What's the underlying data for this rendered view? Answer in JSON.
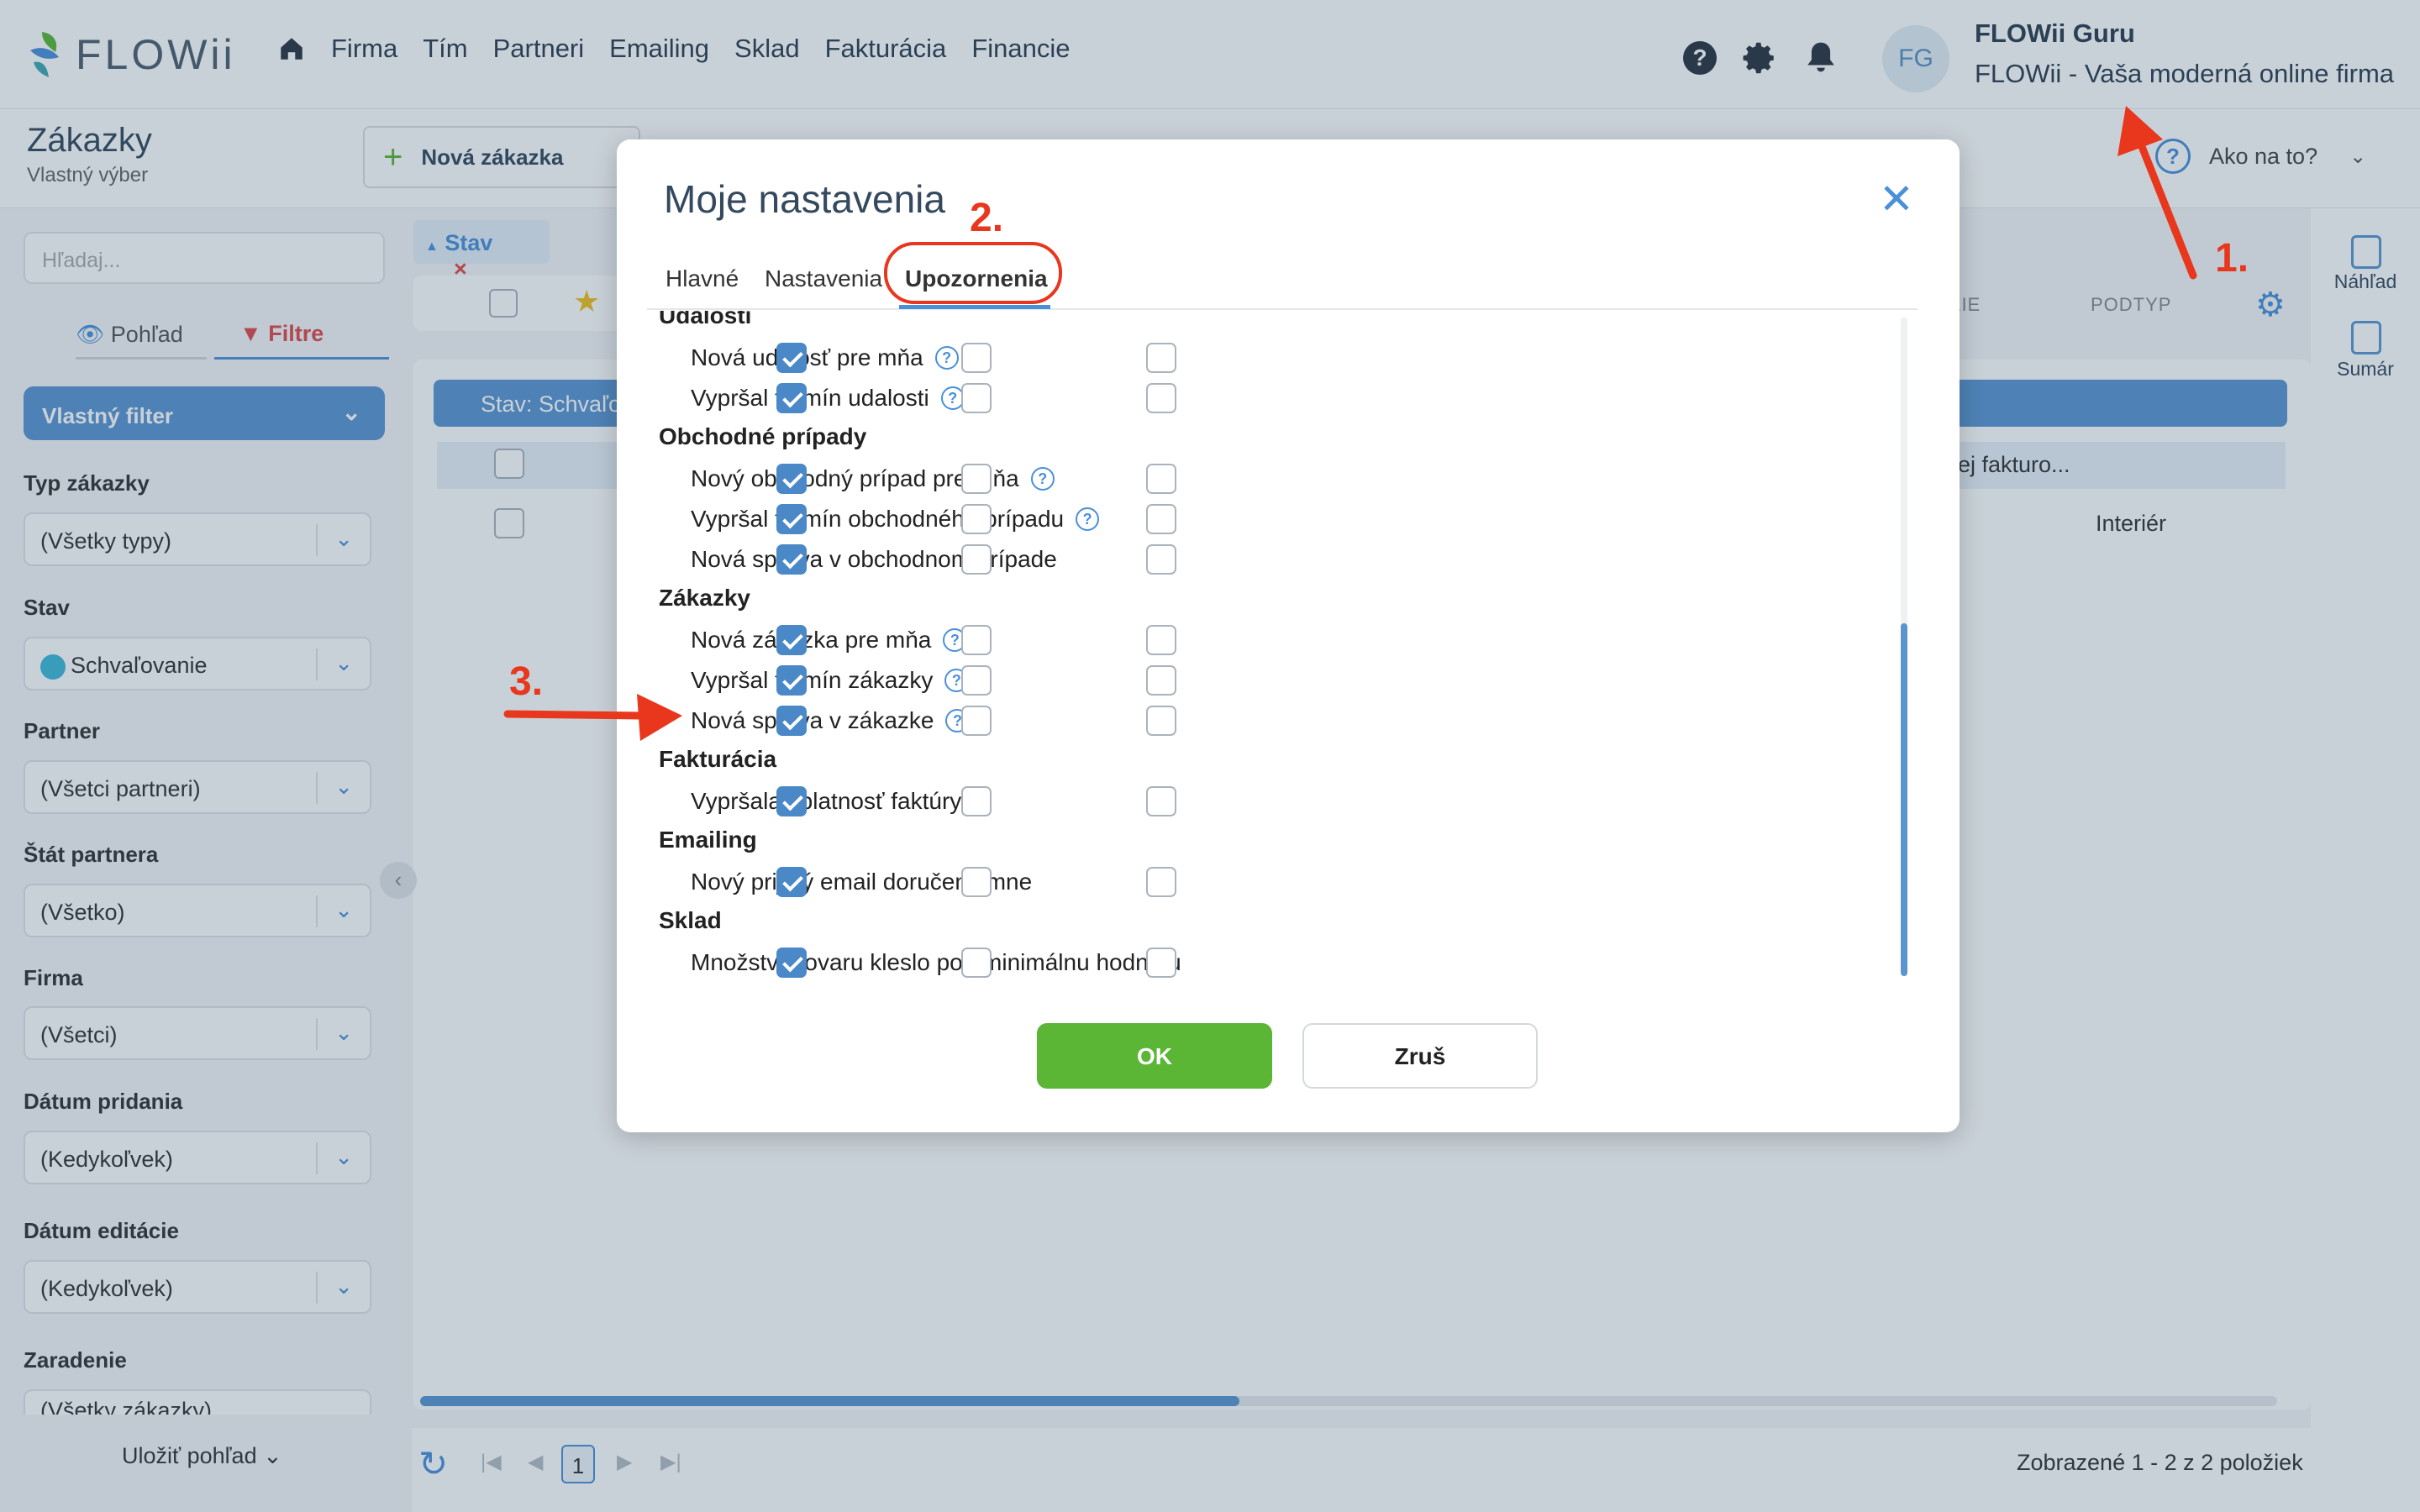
{
  "app": {
    "logo": "FLOWii"
  },
  "nav": [
    "Firma",
    "Tím",
    "Partneri",
    "Emailing",
    "Sklad",
    "Fakturácia",
    "Financie"
  ],
  "user": {
    "initials": "FG",
    "name": "FLOWii Guru",
    "company": "FLOWii - Vaša moderná online firma"
  },
  "page": {
    "title": "Zákazky",
    "subtitle": "Vlastný výber",
    "new_button": "Nová zákazka",
    "help": "Ako na to?"
  },
  "sidebar": {
    "search_placeholder": "Hľadaj...",
    "tab_view": "Pohľad",
    "tab_filters": "Filtre",
    "custom_filter": "Vlastný filter",
    "filters": [
      {
        "label": "Typ zákazky",
        "value": "(Všetky typy)"
      },
      {
        "label": "Stav",
        "value": "Schvaľovanie"
      },
      {
        "label": "Partner",
        "value": "(Všetci partneri)"
      },
      {
        "label": "Štát partnera",
        "value": "(Všetko)"
      },
      {
        "label": "Firma",
        "value": "(Všetci)"
      },
      {
        "label": "Dátum pridania",
        "value": "(Kedykoľvek)"
      },
      {
        "label": "Dátum editácie",
        "value": "(Kedykoľvek)"
      },
      {
        "label": "Zaradenie",
        "value": "(Všetky zákazky)"
      }
    ],
    "save_view": "Uložiť pohľad"
  },
  "main": {
    "stav_pill": "Stav",
    "group_label": "Stav: Schvaľo",
    "col_partial": "ZIE",
    "col_subtype": "PODTYP",
    "row1_text": "ej fakturo...",
    "row2_text": "Interiér",
    "pager_page": "1",
    "pager_summary": "Zobrazené 1 - 2 z 2 položiek"
  },
  "right_panel": {
    "preview": "Náhľad",
    "summary": "Sumár"
  },
  "modal": {
    "title": "Moje nastavenia",
    "tabs": [
      "Hlavné",
      "Nastavenia",
      "Upozornenia"
    ],
    "active_tab": "Upozornenia",
    "sections": [
      {
        "title": "Udalosti",
        "items": [
          {
            "label": "Nová udalosť pre mňa",
            "help": true,
            "checks": [
              true,
              false,
              false
            ]
          },
          {
            "label": "Vypršal termín udalosti",
            "help": true,
            "checks": [
              true,
              false,
              false
            ]
          }
        ]
      },
      {
        "title": "Obchodné prípady",
        "items": [
          {
            "label": "Nový obchodný prípad pre mňa",
            "help": true,
            "checks": [
              true,
              false,
              false
            ]
          },
          {
            "label": "Vypršal termín obchodného prípadu",
            "help": true,
            "checks": [
              true,
              false,
              false
            ]
          },
          {
            "label": "Nová správa v obchodnom prípade",
            "help": false,
            "checks": [
              true,
              false,
              false
            ]
          }
        ]
      },
      {
        "title": "Zákazky",
        "items": [
          {
            "label": "Nová zákazka pre mňa",
            "help": true,
            "checks": [
              true,
              false,
              false
            ]
          },
          {
            "label": "Vypršal termín zákazky",
            "help": true,
            "checks": [
              true,
              false,
              false
            ]
          },
          {
            "label": "Nová správa v zákazke",
            "help": true,
            "checks": [
              true,
              false,
              false
            ]
          }
        ]
      },
      {
        "title": "Fakturácia",
        "items": [
          {
            "label": "Vypršala splatnosť faktúry",
            "help": false,
            "checks": [
              true,
              false,
              false
            ]
          }
        ]
      },
      {
        "title": "Emailing",
        "items": [
          {
            "label": "Nový prijatý email doručený mne",
            "help": false,
            "checks": [
              true,
              false,
              false
            ]
          }
        ]
      },
      {
        "title": "Sklad",
        "items": [
          {
            "label": "Množstvo tovaru kleslo pod minimálnu hodnotu",
            "help": false,
            "checks": [
              true,
              false,
              false
            ]
          }
        ]
      }
    ],
    "ok": "OK",
    "cancel": "Zruš"
  },
  "annotations": [
    "1.",
    "2.",
    "3."
  ],
  "colors": {
    "accent": "#4a90d9",
    "ok": "#5bb636",
    "marker": "#e8371d"
  }
}
